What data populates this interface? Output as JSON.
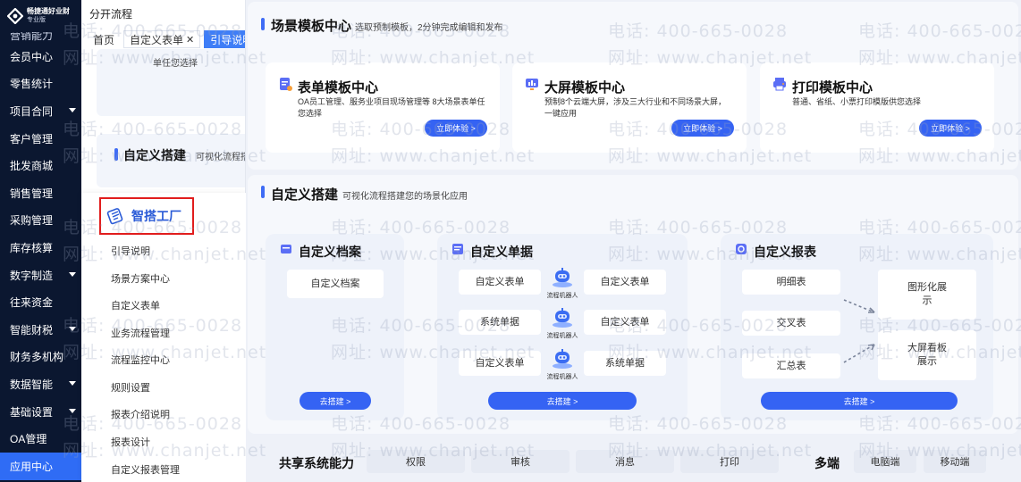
{
  "sidebar": {
    "logo_name": "畅捷通好业财",
    "logo_edition": "专业版",
    "items": [
      {
        "label": "营销能力",
        "caret": false
      },
      {
        "label": "会员中心",
        "caret": false
      },
      {
        "label": "零售统计",
        "caret": false
      },
      {
        "label": "项目合同",
        "caret": true
      },
      {
        "label": "客户管理",
        "caret": false
      },
      {
        "label": "批发商城",
        "caret": false
      },
      {
        "label": "销售管理",
        "caret": false
      },
      {
        "label": "采购管理",
        "caret": false
      },
      {
        "label": "库存核算",
        "caret": false
      },
      {
        "label": "数字制造",
        "caret": true
      },
      {
        "label": "往来资金",
        "caret": false
      },
      {
        "label": "智能财税",
        "caret": true
      },
      {
        "label": "财务多机构",
        "caret": false
      },
      {
        "label": "数据智能",
        "caret": true
      },
      {
        "label": "基础设置",
        "caret": true
      },
      {
        "label": "OA管理",
        "caret": false
      },
      {
        "label": "应用中心",
        "caret": false,
        "active": true
      }
    ]
  },
  "inner": {
    "title": "分开流程",
    "tabs": [
      "首页",
      "自定义表单",
      "引导说明"
    ],
    "card1_desc": "单任您选择",
    "card2_title": "自定义搭建",
    "card2_sub": "可视化流程搭"
  },
  "popup": {
    "title": "智搭工厂",
    "items": [
      "引导说明",
      "场景方案中心",
      "自定义表单",
      "业务流程管理",
      "流程监控中心",
      "规则设置",
      "报表介绍说明",
      "报表设计",
      "自定义报表管理"
    ]
  },
  "scene": {
    "title": "场景模板中心",
    "subtitle": "选取预制模板，2分钟完成编辑和发布",
    "cards": [
      {
        "name": "表单模板中心",
        "desc": "OA员工管理、服务业项目现场管理等 8大场景表单任您选择",
        "btn": "立即体验 >",
        "icon": "form-template-icon"
      },
      {
        "name": "大屏模板中心",
        "desc": "预制8个云端大屏，涉及三大行业和不同场景大屏，一键应用",
        "btn": "立即体验 >",
        "icon": "screen-template-icon"
      },
      {
        "name": "打印模板中心",
        "desc": "普通、省纸、小票打印模版供您选择",
        "btn": "立即体验 >",
        "icon": "print-template-icon"
      }
    ]
  },
  "custom": {
    "title": "自定义搭建",
    "subtitle": "可视化流程搭建您的场景化应用",
    "archive": {
      "title": "自定义档案",
      "pill": "自定义档案",
      "btn": "去搭建 >"
    },
    "docs": {
      "title": "自定义单据",
      "left": [
        "自定义表单",
        "系统单据",
        "自定义表单"
      ],
      "right": [
        "自定义表单",
        "自定义表单",
        "系统单据"
      ],
      "robot_label": "流程机器人",
      "btn": "去搭建 >"
    },
    "report": {
      "title": "自定义报表",
      "left": [
        "明细表",
        "交叉表",
        "汇总表"
      ],
      "right": [
        "图形化展示",
        "大屏看板展示"
      ],
      "btn": "去搭建 >"
    }
  },
  "footer": {
    "shared_title": "共享系统能力",
    "shared_items": [
      "权限",
      "审核",
      "消息",
      "打印"
    ],
    "multi_title": "多端",
    "multi_items": [
      "电脑端",
      "移动端"
    ]
  },
  "watermark": {
    "phone": "电话: 400-665-0028",
    "site": "网址: www.chanjet.net"
  },
  "colors": {
    "accent": "#3563f3",
    "sidebar": "#0b1730",
    "highlight": "#e11d1d"
  }
}
